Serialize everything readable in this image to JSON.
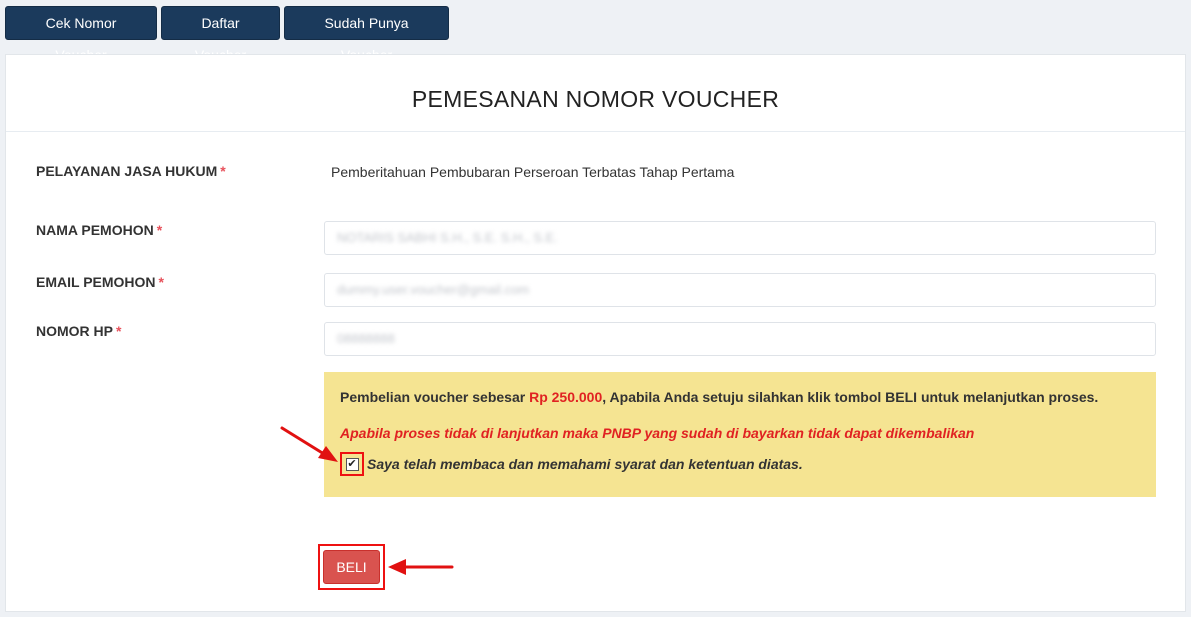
{
  "nav": {
    "buttons": [
      "Cek Nomor Voucher",
      "Daftar Voucher",
      "Sudah Punya Voucher"
    ]
  },
  "form": {
    "title": "PEMESANAN NOMOR VOUCHER",
    "required_mark": "*",
    "layanan_label": "PELAYANAN JASA HUKUM",
    "layanan_value": "Pemberitahuan Pembubaran Perseroan Terbatas Tahap Pertama",
    "nama_label": "NAMA PEMOHON",
    "nama_value": "NOTARIS SABHI S.H., S.E. S.H., S.E.",
    "email_label": "EMAIL PEMOHON",
    "email_value": "dummy.user.voucher@gmail.com",
    "hp_label": "NOMOR HP",
    "hp_value": "08888888"
  },
  "notice": {
    "text_before": "Pembelian voucher sebesar ",
    "price": "Rp 250.000",
    "text_after": ", Apabila Anda setuju silahkan klik tombol BELI untuk melanjutkan proses.",
    "warning": "Apabila proses tidak di lanjutkan maka PNBP yang sudah di bayarkan tidak dapat dikembalikan",
    "agree_label": "Saya telah membaca dan memahami syarat dan ketentuan diatas.",
    "agree_checked": true
  },
  "actions": {
    "beli_label": "BELI"
  },
  "colors": {
    "nav_button": "#1b3a5c",
    "notice_bg": "#f5e492",
    "warning_text": "#e02222",
    "beli_button": "#d9534f",
    "annotation": "#e11111"
  }
}
